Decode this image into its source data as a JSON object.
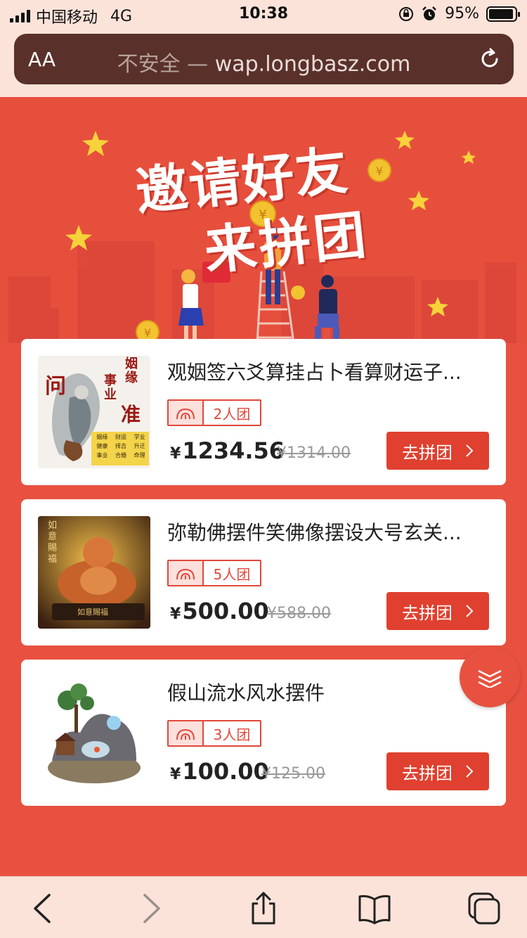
{
  "status_bar": {
    "carrier": "中国移动",
    "network": "4G",
    "time": "10:38",
    "battery_percent": "95%",
    "battery_level": 0.95
  },
  "browser": {
    "aa_label": "AA",
    "insecure_label": "不安全 —",
    "url": "wap.longbasz.com"
  },
  "hero": {
    "title_line1": "邀请好友",
    "title_line2": "来拼团",
    "bg_color": "#e74f3d"
  },
  "products": [
    {
      "title": "观姻签六爻算挂占卜看算财运子...",
      "group_size": "2人团",
      "currency": "¥",
      "price": "1234.56",
      "original_price": "¥1314.00",
      "button": "去拼团",
      "thumb_text": {
        "main": "问",
        "side1": "事业",
        "side2": "姻缘",
        "side3": "准",
        "grid": [
          "姻缘",
          "财运",
          "学业",
          "健康",
          "择吉",
          "升迁",
          "事业",
          "合婚",
          "命理"
        ]
      }
    },
    {
      "title": "弥勒佛摆件笑佛像摆设大号玄关...",
      "group_size": "5人团",
      "currency": "¥",
      "price": "500.00",
      "original_price": "¥588.00",
      "button": "去拼团",
      "thumb_text": {
        "top": "如意賜福",
        "base": "如意賜福"
      }
    },
    {
      "title": "假山流水风水摆件",
      "group_size": "3人团",
      "currency": "¥",
      "price": "100.00",
      "original_price": "¥125.00",
      "button": "去拼团"
    }
  ],
  "icons": {
    "reload": "reload-icon",
    "back": "chevron-left-icon",
    "forward": "chevron-right-icon",
    "share": "share-icon",
    "bookmarks": "book-icon",
    "tabs": "tabs-icon",
    "scroll": "chevron-double-down-icon",
    "group": "group-icon"
  },
  "colors": {
    "accent": "#e0402f",
    "page_bg": "#e8513f",
    "toolbar_bg": "#fbe3da"
  }
}
